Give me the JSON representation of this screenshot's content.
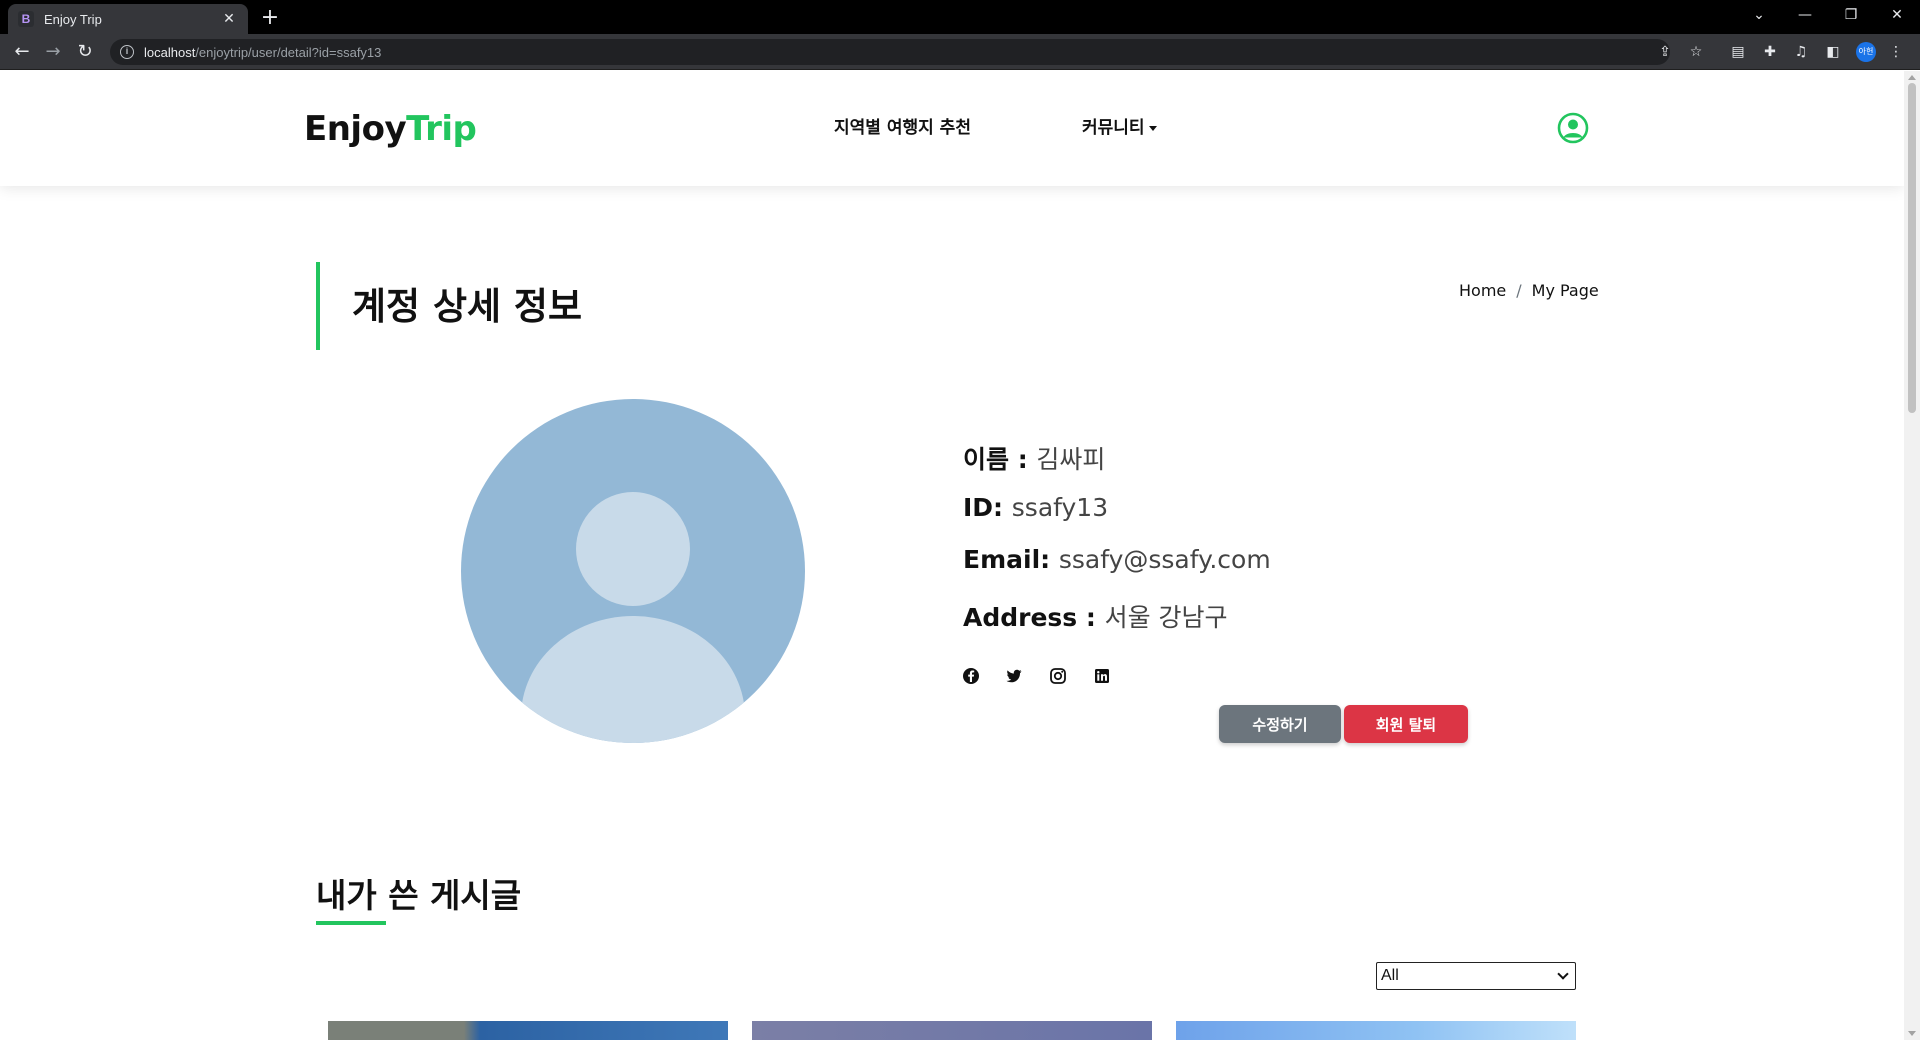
{
  "browser": {
    "tab_title": "Enjoy Trip",
    "tab_favicon": "B",
    "url_host": "localhost",
    "url_path": "/enjoytrip/user/detail?id=ssafy13",
    "profile_initial": "아헌"
  },
  "header": {
    "logo_part1": "Enjoy",
    "logo_part2": "Trip",
    "nav": [
      {
        "label": "지역별 여행지 추천"
      },
      {
        "label": "커뮤니티"
      }
    ]
  },
  "page": {
    "title": "계정 상세 정보",
    "breadcrumb": {
      "home": "Home",
      "sep": "/",
      "current": "My Page"
    }
  },
  "profile": {
    "name_label": "이름 : ",
    "name_value": "김싸피",
    "id_label": "ID: ",
    "id_value": "ssafy13",
    "email_label": "Email: ",
    "email_value": "ssafy@ssafy.com",
    "address_label": "Address : ",
    "address_value": "서울 강남구",
    "social_icons": [
      "facebook-icon",
      "twitter-icon",
      "instagram-icon",
      "linkedin-icon"
    ]
  },
  "actions": {
    "edit_label": "수정하기",
    "delete_label": "회원 탈퇴"
  },
  "posts": {
    "title": "내가 쓴 게시글",
    "filter_selected": "All"
  },
  "colors": {
    "accent": "#22c55e",
    "secondary_button": "#6c757d",
    "danger_button": "#dc3545",
    "avatar_bg": "#93b8d6"
  }
}
